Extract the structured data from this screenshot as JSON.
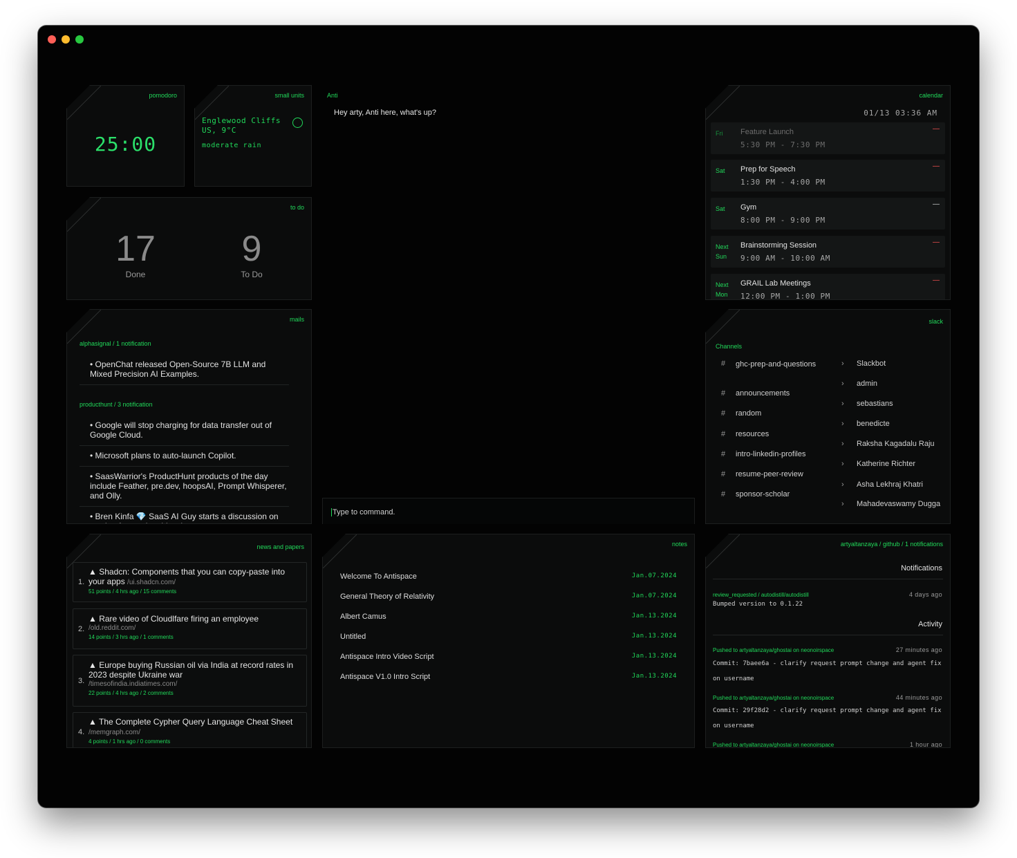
{
  "pomodoro": {
    "title": "pomodoro",
    "time": "25:00"
  },
  "weather": {
    "title": "small units",
    "location_line1": "Englewood Cliffs",
    "location_line2": "US, 9°C",
    "description": "moderate rain",
    "icon": "weather-icon"
  },
  "todo": {
    "title": "to do",
    "done_count": "17",
    "done_label": "Done",
    "todo_count": "9",
    "todo_label": "To Do"
  },
  "mails": {
    "title": "mails",
    "groups": [
      {
        "header": "alphasignal  / 1 notification",
        "items": [
          "• OpenChat released Open-Source 7B LLM and Mixed Precision AI Examples."
        ]
      },
      {
        "header": "producthunt  / 3 notification",
        "items": [
          "• Google will stop charging for data transfer out of Google Cloud.",
          "• Microsoft plans to auto-launch Copilot.",
          "• SaasWarrior's ProductHunt products of the day include Feather, pre.dev, hoopsAI, Prompt Whisperer, and Olly.",
          "• Bren Kinfa 💎 SaaS AI Guy starts a discussion on staying focused amidst chaos."
        ]
      }
    ]
  },
  "chat": {
    "name": "Anti",
    "message": "Hey arty, Anti here, what's up?",
    "input_placeholder": "Type to command."
  },
  "calendar": {
    "title": "calendar",
    "datetime": "01/13  03:36 AM",
    "events": [
      {
        "day": "Fri",
        "title": "Feature Launch",
        "time": "5:30 PM - 7:30 PM",
        "faded": true,
        "dash": "red"
      },
      {
        "day": "Sat",
        "title": "Prep for Speech",
        "time": "1:30 PM - 4:00 PM",
        "faded": false,
        "dash": "red"
      },
      {
        "day": "Sat",
        "title": "Gym",
        "time": "8:00 PM - 9:00 PM",
        "faded": false,
        "dash": "white"
      },
      {
        "day": "Next Sun",
        "title": "Brainstorming Session",
        "time": "9:00 AM - 10:00 AM",
        "faded": false,
        "dash": "red"
      },
      {
        "day": "Next Mon",
        "title": "GRAIL Lab Meetings",
        "time": "12:00 PM - 1:00 PM",
        "faded": false,
        "dash": "red"
      }
    ]
  },
  "slack": {
    "title": "slack",
    "channels_header": "Channels",
    "channels": [
      "ghc-prep-and-questions",
      "announcements",
      "random",
      "resources",
      "intro-linkedin-profiles",
      "resume-peer-review",
      "sponsor-scholar"
    ],
    "dms": [
      "Slackbot",
      "admin",
      "sebastians",
      "benedicte",
      "Raksha Kagadalu Raju",
      "Katherine Richter",
      "Asha Lekhraj Khatri",
      "Mahadevaswamy Dugga"
    ]
  },
  "news": {
    "title": "news and papers",
    "items": [
      {
        "num": "1.",
        "title": "▲ Shadcn: Components that you can copy-paste into your apps",
        "domain": "/ui.shadcn.com/",
        "meta": "51 points / 4 hrs ago / 15 comments"
      },
      {
        "num": "2.",
        "title": "▲ Rare video of Cloudlfare firing an employee",
        "domain": "/old.reddit.com/",
        "meta": "14 points / 3 hrs ago / 1 comments"
      },
      {
        "num": "3.",
        "title": "▲ Europe buying Russian oil via India at record rates in 2023 despite Ukraine war",
        "domain": "/timesofindia.indiatimes.com/",
        "meta": "22 points / 4 hrs ago / 2 comments"
      },
      {
        "num": "4.",
        "title": "▲ The Complete Cypher Query Language Cheat Sheet",
        "domain": "/memgraph.com/",
        "meta": "4 points / 1 hrs ago / 0 comments"
      }
    ]
  },
  "notes": {
    "title": "notes",
    "items": [
      {
        "name": "Welcome To Antispace",
        "date": "Jan.07.2024"
      },
      {
        "name": "General Theory of Relativity",
        "date": "Jan.07.2024"
      },
      {
        "name": "Albert Camus",
        "date": "Jan.13.2024"
      },
      {
        "name": "Untitled",
        "date": "Jan.13.2024"
      },
      {
        "name": "Antispace Intro Video Script",
        "date": "Jan.13.2024"
      },
      {
        "name": "Antispace V1.0 Intro Script",
        "date": "Jan.13.2024"
      }
    ]
  },
  "github": {
    "title": "artyaltanzaya / github / 1 notifications",
    "notifications_header": "Notifications",
    "notification": {
      "link": "review_requested / autodistill/autodistill",
      "ago": "4 days ago",
      "text": "Bumped version to 0.1.22"
    },
    "activity_header": "Activity",
    "activity": [
      {
        "link": "Pushed to artyaltanzaya/ghostai on neonoirspace",
        "ago": "27 minutes ago",
        "text": "Commit: 7baee6a - clarify request prompt change and agent fix on username"
      },
      {
        "link": "Pushed to artyaltanzaya/ghostai on neonoirspace",
        "ago": "44 minutes ago",
        "text": "Commit: 29f28d2 - clarify request prompt change and agent fix on username"
      },
      {
        "link": "Pushed to artyaltanzaya/ghostai on neonoirspace",
        "ago": "1 hour ago",
        "text": ""
      }
    ]
  },
  "colors": {
    "accent": "#21d95a",
    "background": "#030303",
    "panel": "#0b0c0c",
    "alert": "#ff5555"
  }
}
